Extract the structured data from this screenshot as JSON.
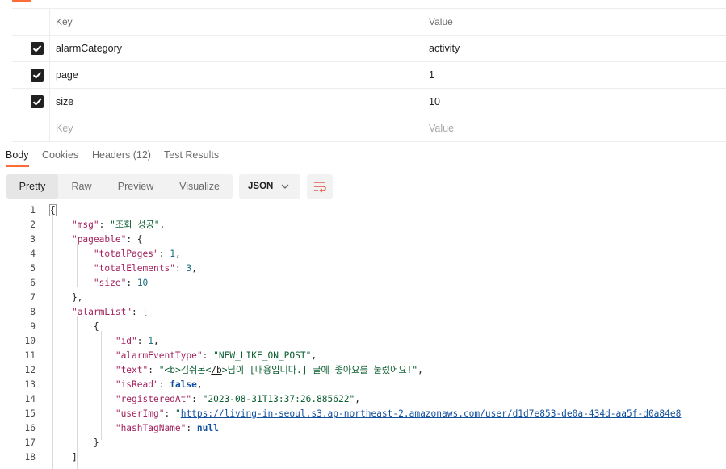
{
  "params": {
    "header": {
      "key": "Key",
      "value": "Value"
    },
    "rows": [
      {
        "key": "alarmCategory",
        "value": "activity",
        "checked": true
      },
      {
        "key": "page",
        "value": "1",
        "checked": true
      },
      {
        "key": "size",
        "value": "10",
        "checked": true
      }
    ],
    "placeholder": {
      "key": "Key",
      "value": "Value"
    }
  },
  "response_tabs": [
    "Body",
    "Cookies",
    "Headers (12)",
    "Test Results"
  ],
  "format": {
    "modes": [
      "Pretty",
      "Raw",
      "Preview",
      "Visualize"
    ],
    "active_mode": "Pretty",
    "language": "JSON",
    "icons": {
      "dropdown": "chevron-down-icon",
      "wrap": "wrap-lines-icon"
    },
    "accent_color": "#ff6c37"
  },
  "code_lines": [
    "{",
    "    \"msg\": \"조회 성공\",",
    "    \"pageable\": {",
    "        \"totalPages\": 1,",
    "        \"totalElements\": 3,",
    "        \"size\": 10",
    "    },",
    "    \"alarmList\": [",
    "        {",
    "            \"id\": 1,",
    "            \"alarmEventType\": \"NEW_LIKE_ON_POST\",",
    "            \"text\": \"<b>김쉬몬</b>님이 [내용입니다.] 글에 좋아요를 눌렀어요!\",",
    "            \"isRead\": false,",
    "            \"registeredAt\": \"2023-08-31T13:37:26.885622\",",
    "            \"userImg\": \"https://living-in-seoul.s3.ap-northeast-2.amazonaws.com/user/d1d7e853-de0a-434d-aa5f-d0a84e8",
    "            \"hashTagName\": null",
    "        }",
    "    ]"
  ]
}
